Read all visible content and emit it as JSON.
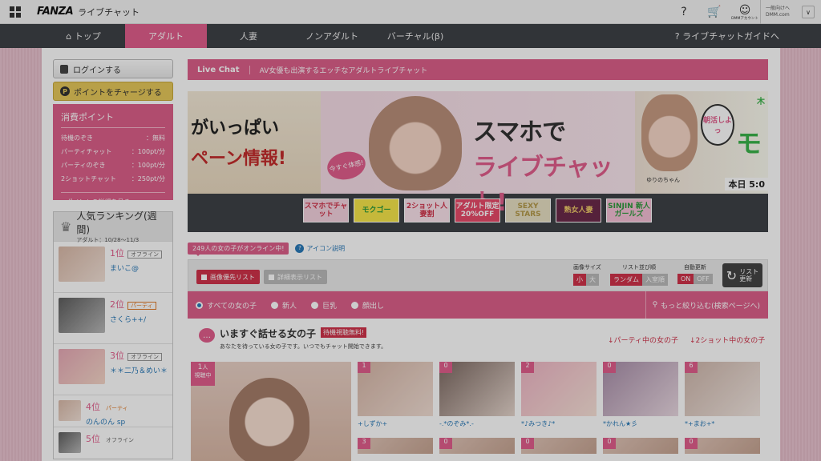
{
  "header": {
    "logo": "FANZA",
    "service": "ライブチャット",
    "help_label": "?",
    "cart_label": "🛒",
    "account_label": "DMMアカウント",
    "account_lines": [
      "一般向けへ",
      "DMM.com"
    ],
    "dropdown": "∨"
  },
  "nav": {
    "items": [
      {
        "label": "⌂ トップ"
      },
      {
        "label": "アダルト"
      },
      {
        "label": "人妻"
      },
      {
        "label": "ノンアダルト"
      },
      {
        "label": "バーチャル(β)"
      }
    ],
    "guide": "? ライブチャットガイドへ"
  },
  "sidebar": {
    "login": "ログインする",
    "charge": "ポイントをチャージする",
    "charge_icon": "P",
    "points_title": "消費ポイント",
    "points": [
      {
        "label": "待機のぞき",
        "value": "：無料"
      },
      {
        "label": "パーティチャット",
        "value": "：100pt/分"
      },
      {
        "label": "パーティのぞき",
        "value": "：100pt/分"
      },
      {
        "label": "2ショットチャット",
        "value": "：250pt/分"
      }
    ],
    "points_link": "▸ ポイントの詳細を見る",
    "ranking_title": "人気ランキング(週間)",
    "ranking_sub": "アダルト：10/28〜11/3",
    "ranking": [
      {
        "pos": "1位",
        "status": "オフライン",
        "name": "まいこ@"
      },
      {
        "pos": "2位",
        "status": "パーティ",
        "name": "さくら++/"
      },
      {
        "pos": "3位",
        "status": "オフライン",
        "name": "＊＊二乃＆めい＊"
      },
      {
        "pos": "4位",
        "status": "パーティ",
        "name": "のんのん sp"
      },
      {
        "pos": "5位",
        "status": "オフライン",
        "name": ""
      }
    ]
  },
  "main": {
    "livechat_title": "Live Chat",
    "livechat_desc": "AV女優も出演するエッチなアダルトライブチャット",
    "banner": {
      "left_line1": "がいっぱい",
      "left_line2": "ペーン情報!",
      "try_badge": "今すぐ体感!",
      "center_line1": "スマホで",
      "center_line2": "ライブチャット!",
      "right_name": "ゆりのちゃん",
      "right_badge": "朝活しよっ",
      "right_big": "モ",
      "right_ki": "木",
      "right_today": "本日 5:0",
      "thumbs": [
        "スマホでチャット",
        "モクゴー",
        "2ショット人妻割",
        "アダルト限定20%OFF",
        "SEXY STARS",
        "熟女人妻",
        "SINJIN 新人ガールズ"
      ]
    },
    "online_count": "249人の女の子がオンライン中!",
    "icon_help": "アイコン説明",
    "view_image": "画像優先リスト",
    "view_detail": "詳細表示リスト",
    "image_size_label": "画像サイズ",
    "image_size_options": [
      "小",
      "大"
    ],
    "sort_label": "リスト並び順",
    "sort_options": [
      "ランダム",
      "入室順"
    ],
    "auto_label": "自動更新",
    "auto_options": [
      "ON",
      "OFF"
    ],
    "refresh": [
      "リスト",
      "更新"
    ],
    "filters": [
      "すべての女の子",
      "新人",
      "巨乳",
      "顔出し"
    ],
    "more_filter": "もっと絞り込む(検索ページへ)",
    "section_title": "いますぐ話せる女の子",
    "section_badge": "待機視聴無料!",
    "section_desc": "あなたを待っている女の子です。いつでもチャット開始できます。",
    "link_party": "↓パーティ中の女の子",
    "link_2shot": "↓2ショット中の女の子",
    "featured_count": [
      "1",
      "人",
      "視聴中"
    ],
    "girls": [
      {
        "n": "1",
        "name": "+しずか+",
        "n2": "3"
      },
      {
        "n": "0",
        "name": "-.*のぞみ*.-",
        "n2": "0"
      },
      {
        "n": "2",
        "name": "*♪みつき♪*",
        "n2": "0"
      },
      {
        "n": "0",
        "name": "*かれん★彡",
        "n2": "0"
      },
      {
        "n": "6",
        "name": "*+まお+*",
        "n2": "0"
      }
    ]
  },
  "colors": {
    "accent": "#dc5f8a",
    "nav_bg": "#3e4147",
    "link": "#2a7ab8",
    "red": "#d0334a"
  }
}
